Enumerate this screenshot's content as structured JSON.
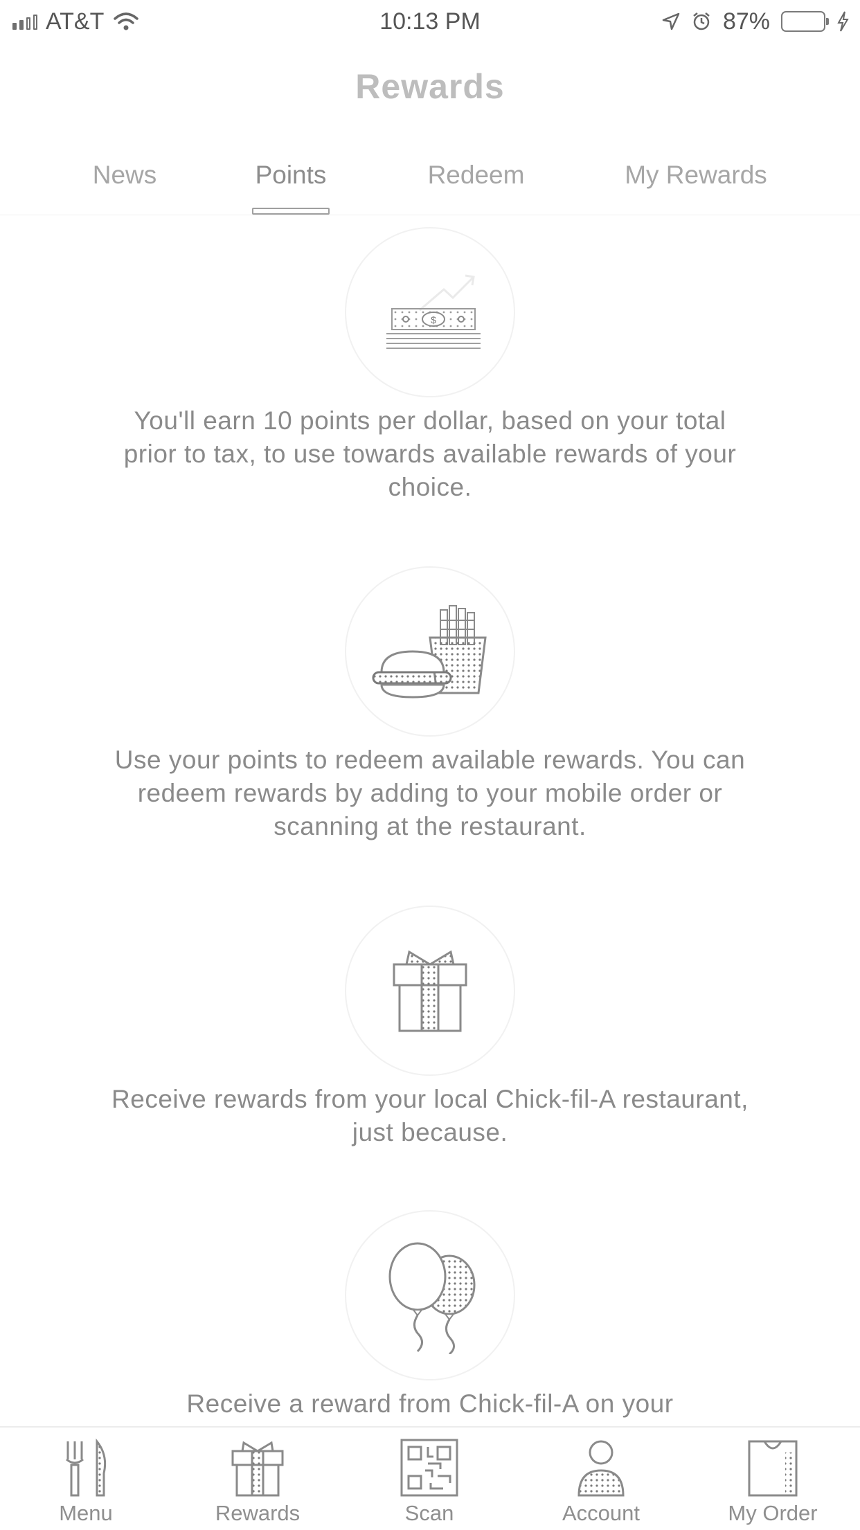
{
  "status_bar": {
    "carrier": "AT&T",
    "time": "10:13 PM",
    "battery": "87%"
  },
  "header": {
    "title": "Rewards"
  },
  "tabs": [
    {
      "label": "News",
      "active": false
    },
    {
      "label": "Points",
      "active": true
    },
    {
      "label": "Redeem",
      "active": false
    },
    {
      "label": "My Rewards",
      "active": false
    }
  ],
  "features": [
    {
      "icon": "money-icon",
      "text": "You'll earn 10 points per dollar, based on your total prior to tax, to use towards available rewards of your choice."
    },
    {
      "icon": "sandwich-fries-icon",
      "text": "Use your points to redeem available rewards. You can redeem rewards by adding to your mobile order or scanning at the restaurant."
    },
    {
      "icon": "gift-icon",
      "text": "Receive rewards from your local Chick-fil-A restaurant, just because."
    },
    {
      "icon": "balloons-icon",
      "text": "Receive a reward from Chick-fil-A on your"
    }
  ],
  "bottom_nav": [
    {
      "label": "Menu",
      "icon": "fork-knife-icon"
    },
    {
      "label": "Rewards",
      "icon": "gift-icon"
    },
    {
      "label": "Scan",
      "icon": "qr-code-icon"
    },
    {
      "label": "Account",
      "icon": "person-icon"
    },
    {
      "label": "My Order",
      "icon": "bag-icon"
    }
  ]
}
